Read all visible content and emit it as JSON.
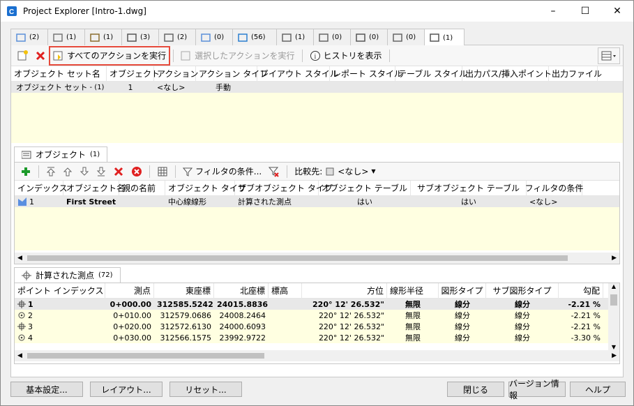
{
  "window": {
    "title": "Project Explorer [Intro-1.dwg]",
    "minimize": "–",
    "maximize": "☐",
    "close": "✕"
  },
  "tabs": [
    {
      "icon": "alignment-icon",
      "count": "(2)"
    },
    {
      "icon": "profile-icon",
      "count": "(1)"
    },
    {
      "icon": "surface-icon",
      "count": "(1)"
    },
    {
      "icon": "sample-line-icon",
      "count": "(3)"
    },
    {
      "icon": "corridor-icon",
      "count": "(2)"
    },
    {
      "icon": "pipe-icon",
      "count": "(0)"
    },
    {
      "icon": "feature-line-icon",
      "count": "(56)"
    },
    {
      "icon": "structure-icon",
      "count": "(1)"
    },
    {
      "icon": "pressure-fitting-icon",
      "count": "(0)"
    },
    {
      "icon": "bracket-icon",
      "count": "(0)"
    },
    {
      "icon": "view-icon",
      "count": "(0)"
    },
    {
      "icon": "object-set-icon",
      "count": "(1)"
    }
  ],
  "toolbar": {
    "run_all": "すべてのアクションを実行",
    "run_selected": "選択したアクションを実行",
    "show_history": "ヒストリを表示"
  },
  "object_sets": {
    "columns": [
      "オブジェクト セット名",
      "オブジェクト",
      "アクション",
      "アクション タイプ",
      "レイアウト スタイル",
      "レポート スタイル",
      "テーブル スタイル",
      "出力パス/挿入ポイント",
      "出力ファイル"
    ],
    "row": {
      "name": "オブジェクト セット",
      "suffix": " - (1)",
      "objects": "1",
      "action": "<なし>",
      "action_type": "手動"
    }
  },
  "objects_tab": {
    "label": "オブジェクト",
    "count": "(1)"
  },
  "objects_toolbar": {
    "filter": "フィルタの条件...",
    "compare": "比較先:",
    "compare_value": "<なし>"
  },
  "objects": {
    "columns": [
      "インデックス",
      "オブジェクト名",
      "親の名前",
      "オブジェクト タイプ",
      "サブオブジェクト タイプ",
      "オブジェクト テーブル",
      "サブオブジェクト テーブル",
      "フィルタの条件"
    ],
    "row": {
      "index": "1",
      "name": "First Street",
      "parent": "",
      "type": "中心線線形",
      "sub_type": "計算された測点",
      "table": "はい",
      "sub_table": "はい",
      "filter": "<なし>"
    }
  },
  "points_tab": {
    "label": "計算された測点",
    "count": "(72)"
  },
  "points": {
    "columns": [
      "ポイント インデックス",
      "測点",
      "東座標",
      "北座標",
      "標高",
      "方位",
      "線形半径",
      "図形タイプ",
      "サブ図形タイプ",
      "勾配"
    ],
    "rows": [
      {
        "idx": "1",
        "sta": "0+000.00",
        "east": "312585.5242",
        "north": "24015.8836",
        "elev": "",
        "bearing": "220° 12' 26.532\"",
        "radius": "無限",
        "geom": "線分",
        "subgeom": "線分",
        "grade": "-2.21 %",
        "bold": true,
        "icon": "crosshair"
      },
      {
        "idx": "2",
        "sta": "0+010.00",
        "east": "312579.0686",
        "north": "24008.2464",
        "elev": "",
        "bearing": "220° 12' 26.532\"",
        "radius": "無限",
        "geom": "線分",
        "subgeom": "線分",
        "grade": "-2.21 %",
        "bold": false,
        "icon": "target"
      },
      {
        "idx": "3",
        "sta": "0+020.00",
        "east": "312572.6130",
        "north": "24000.6093",
        "elev": "",
        "bearing": "220° 12' 26.532\"",
        "radius": "無限",
        "geom": "線分",
        "subgeom": "線分",
        "grade": "-2.21 %",
        "bold": false,
        "icon": "crosshair"
      },
      {
        "idx": "4",
        "sta": "0+030.00",
        "east": "312566.1575",
        "north": "23992.9722",
        "elev": "",
        "bearing": "220° 12' 26.532\"",
        "radius": "無限",
        "geom": "線分",
        "subgeom": "線分",
        "grade": "-3.30 %",
        "bold": false,
        "icon": "target"
      }
    ]
  },
  "buttons": {
    "settings": "基本設定...",
    "layout": "レイアウト...",
    "reset": "リセット...",
    "close": "閉じる",
    "version": "バージョン情報",
    "help": "ヘルプ"
  }
}
